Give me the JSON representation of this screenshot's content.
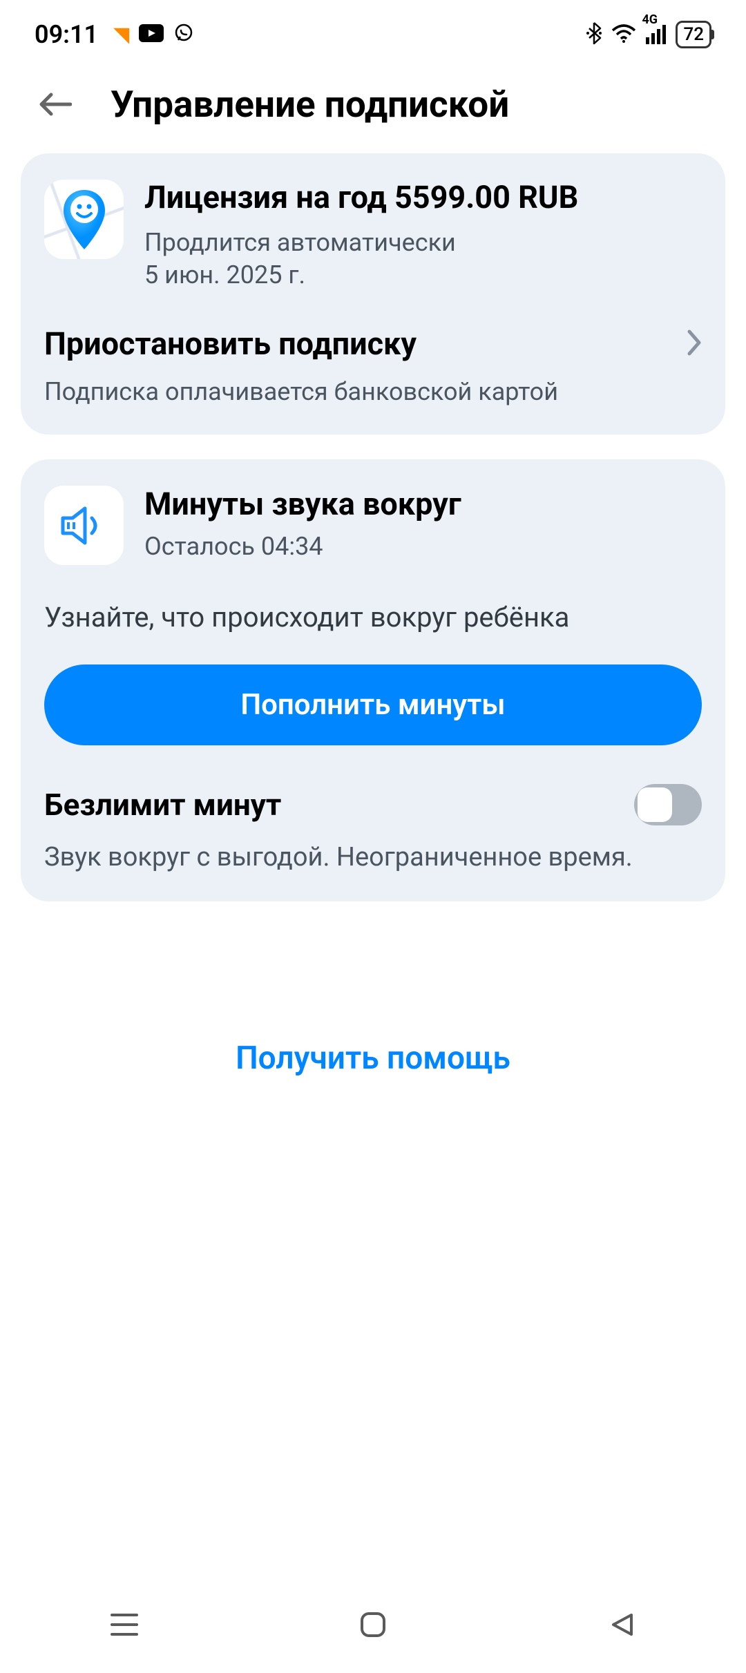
{
  "statusBar": {
    "time": "09:11",
    "battery": "72"
  },
  "header": {
    "title": "Управление подпиской"
  },
  "license": {
    "title": "Лицензия на год 5599.00 RUB",
    "renewal_line1": "Продлится автоматически",
    "renewal_line2": "5 июн. 2025 г.",
    "pause_label": "Приостановить подписку",
    "payment_method": "Подписка оплачивается банковской картой"
  },
  "sound": {
    "title": "Минуты звука вокруг",
    "remaining": "Осталось 04:34",
    "description": "Узнайте, что происходит вокруг ребёнка",
    "topup_label": "Пополнить минуты",
    "unlimited_label": "Безлимит минут",
    "unlimited_description": "Звук вокруг с выгодой. Неограниченное время."
  },
  "help": {
    "label": "Получить помощь"
  }
}
